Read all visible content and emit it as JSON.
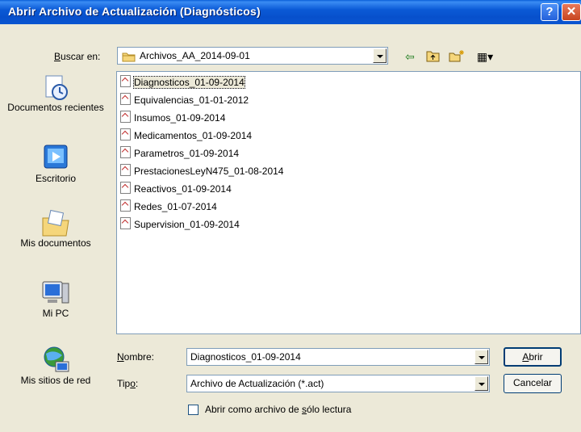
{
  "window": {
    "title": "Abrir Archivo de Actualización (Diagnósticos)",
    "help_icon": "?",
    "close_icon": "✕"
  },
  "lookin": {
    "label_pre": "B",
    "label_rest": "uscar en:",
    "value": "Archivos_AA_2014-09-01"
  },
  "toolbar": {
    "back_icon": "⇦",
    "up_icon": "⮤",
    "newfolder_icon": "✳",
    "views_icon": "▦▾"
  },
  "places": [
    {
      "label": "Documentos recientes",
      "icon": "recent-documents-icon"
    },
    {
      "label": "Escritorio",
      "icon": "desktop-icon"
    },
    {
      "label": "Mis documentos",
      "icon": "my-documents-icon"
    },
    {
      "label": "Mi PC",
      "icon": "my-computer-icon"
    },
    {
      "label": "Mis sitios de red",
      "icon": "network-places-icon"
    }
  ],
  "files": [
    "Diagnosticos_01-09-2014",
    "Equivalencias_01-01-2012",
    "Insumos_01-09-2014",
    "Medicamentos_01-09-2014",
    "Parametros_01-09-2014",
    "PrestacionesLeyN475_01-08-2014",
    "Reactivos_01-09-2014",
    "Redes_01-07-2014",
    "Supervision_01-09-2014"
  ],
  "selected_file": "Diagnosticos_01-09-2014",
  "filename": {
    "label_pre": "N",
    "label_rest": "ombre:",
    "value": "Diagnosticos_01-09-2014"
  },
  "filetype": {
    "label_pre": "Tip",
    "label_u": "o",
    "label_rest": ":",
    "value": "Archivo de Actualización (*.act)"
  },
  "readonly": {
    "label_pre": "Abrir como archivo de ",
    "label_u": "s",
    "label_rest": "ólo lectura",
    "checked": false
  },
  "buttons": {
    "open_u": "A",
    "open_rest": "brir",
    "cancel": "Cancelar"
  }
}
